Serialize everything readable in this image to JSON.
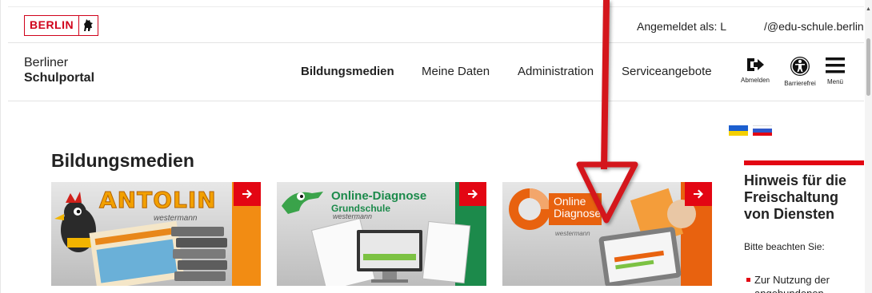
{
  "topbar": {
    "logo_text": "BERLIN",
    "login_label": "Angemeldet als: L",
    "login_email": "/@edu-schule.berlin"
  },
  "header": {
    "brand_line1": "Berliner",
    "brand_line2": "Schulportal",
    "nav": [
      {
        "label": "Bildungsmedien"
      },
      {
        "label": "Meine Daten"
      },
      {
        "label": "Administration"
      },
      {
        "label": "Serviceangebote"
      }
    ],
    "tools": [
      {
        "label": "Abmelden",
        "icon": "logout-icon"
      },
      {
        "label": "Barrierefrei",
        "icon": "accessibility-icon"
      },
      {
        "label": "Menü",
        "icon": "hamburger-menu-icon"
      }
    ]
  },
  "flags": [
    {
      "name": "ukrainian-flag",
      "top": "#1c5fcf",
      "bottom": "#f4d000"
    },
    {
      "name": "russian-flag",
      "top": "#2f58c9",
      "bottom": "#e30613"
    }
  ],
  "main": {
    "title": "Bildungsmedien",
    "cards": [
      {
        "title": "ANTOLIN",
        "subtitle": "westermann",
        "accent": "#f28c13"
      },
      {
        "title": "Online-Diagnose",
        "title2": "Grundschule",
        "subtitle": "westermann",
        "accent": "#1c8a4b"
      },
      {
        "title": "Online",
        "title2": "Diagnose",
        "subtitle": "westermann",
        "accent": "#e8620f"
      }
    ]
  },
  "sidebar": {
    "title": "Hinweis für die Freischaltung von Diensten",
    "text": "Bitte beachten Sie:",
    "bullet": "Zur Nutzung der",
    "bullet_cut": "angebundenen"
  },
  "colors": {
    "accent_red": "#e30613",
    "annotation_red": "#d4141e"
  }
}
